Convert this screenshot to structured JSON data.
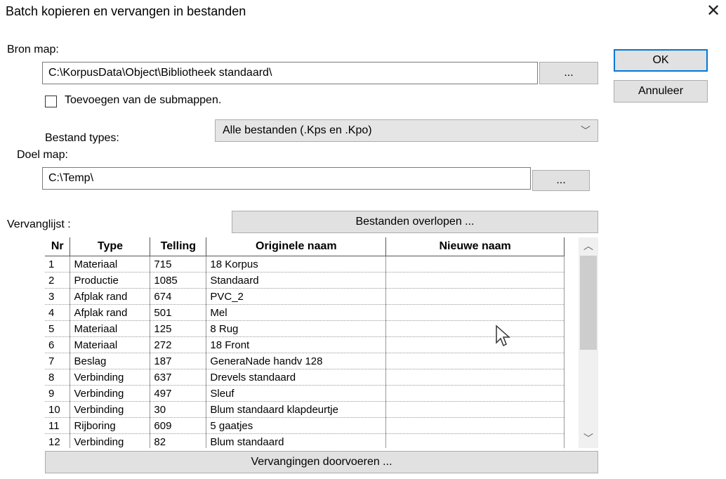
{
  "window": {
    "title": "Batch kopieren en vervangen in bestanden",
    "close": "✕"
  },
  "source": {
    "label": "Bron map:",
    "path": "C:\\KorpusData\\Object\\Bibliotheek standaard\\",
    "browse": "..."
  },
  "subfolders": {
    "label": "Toevoegen van de submappen.",
    "checked": false
  },
  "filetypes": {
    "label": "Bestand types:",
    "selected": "Alle bestanden (.Kps en .Kpo)",
    "chevron": "﹀"
  },
  "target": {
    "label": "Doel map:",
    "path": "C:\\Temp\\",
    "browse": "..."
  },
  "replace": {
    "label": "Vervanglijst :",
    "scan_button": "Bestanden overlopen ...",
    "apply_button": "Vervangingen doorvoeren ..."
  },
  "buttons": {
    "ok": "OK",
    "cancel": "Annuleer"
  },
  "grid": {
    "columns": [
      "Nr",
      "Type",
      "Telling",
      "Originele naam",
      "Nieuwe naam"
    ],
    "rows": [
      [
        "1",
        "Materiaal",
        "715",
        "18 Korpus",
        ""
      ],
      [
        "2",
        "Productie",
        "1085",
        "Standaard",
        ""
      ],
      [
        "3",
        "Afplak rand",
        "674",
        "PVC_2",
        ""
      ],
      [
        "4",
        "Afplak rand",
        "501",
        "Mel",
        ""
      ],
      [
        "5",
        "Materiaal",
        "125",
        "8 Rug",
        ""
      ],
      [
        "6",
        "Materiaal",
        "272",
        "18 Front",
        ""
      ],
      [
        "7",
        "Beslag",
        "187",
        "GeneraNade handv 128",
        ""
      ],
      [
        "8",
        "Verbinding",
        "637",
        "Drevels standaard",
        ""
      ],
      [
        "9",
        "Verbinding",
        "497",
        "Sleuf",
        ""
      ],
      [
        "10",
        "Verbinding",
        "30",
        "Blum standaard klapdeurtje",
        ""
      ],
      [
        "11",
        "Rijboring",
        "609",
        "5 gaatjes",
        ""
      ],
      [
        "12",
        "Verbinding",
        "82",
        "Blum standaard",
        ""
      ]
    ]
  },
  "scrollbar": {
    "up": "︿",
    "down": "﹀"
  }
}
